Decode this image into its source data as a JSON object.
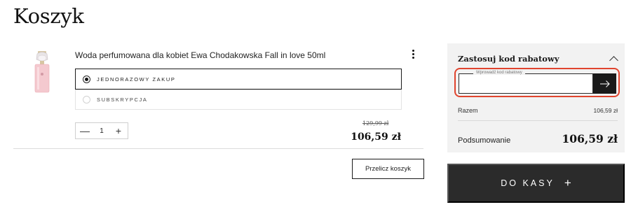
{
  "page": {
    "title": "Koszyk"
  },
  "cart": {
    "items": [
      {
        "name": "Woda perfumowana dla kobiet Ewa Chodakowska Fall in love 50ml",
        "image_icon": "perfume-bottle-icon",
        "purchase_options": [
          {
            "label": "JEDNORAZOWY ZAKUP",
            "selected": true
          },
          {
            "label": "SUBSKRYPCJA",
            "selected": false
          }
        ],
        "quantity": {
          "minus": "—",
          "value": "1",
          "plus": "+"
        },
        "price_old": "129,99 zł",
        "price_new": "106,59 zł"
      }
    ],
    "recalc_label": "Przelicz koszyk"
  },
  "summary": {
    "coupon_title": "Zastosuj kod rabatowy",
    "coupon_placeholder": "Wprowadź kod rabatowy",
    "subtotal_label": "Razem",
    "subtotal_value": "106,59 zł",
    "total_label": "Podsumowanie",
    "total_value": "106,59 zł",
    "checkout_label": "DO KASY",
    "checkout_icon": "+"
  },
  "colors": {
    "highlight": "#e0442e",
    "dark_button": "#2b2b2b",
    "panel_background": "#f2f2f2"
  }
}
